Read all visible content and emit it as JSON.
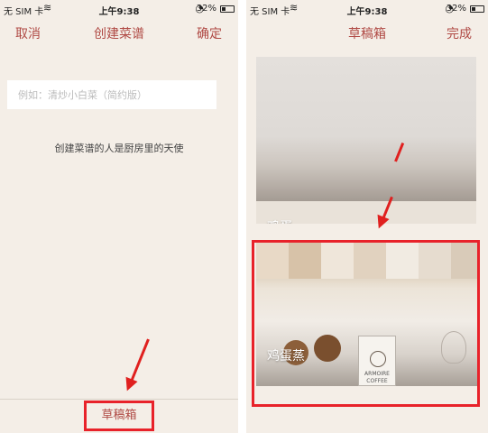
{
  "left_screen": {
    "status_bar": {
      "carrier": "无 SIM 卡",
      "time": "上午9:38",
      "battery": "32%"
    },
    "nav": {
      "cancel": "取消",
      "title": "创建菜谱",
      "confirm": "确定"
    },
    "recipe_name_placeholder": "例如：清炒小白菜（简约版）",
    "tip": "创建菜谱的人是厨房里的天使",
    "draft_box_button": "草稿箱"
  },
  "right_screen": {
    "status_bar": {
      "carrier": "无 SIM 卡",
      "time": "上午9:38",
      "battery": "32%"
    },
    "nav": {
      "title": "草稿箱",
      "done": "完成"
    },
    "drafts": [
      {
        "title": "鸡蛋"
      },
      {
        "title": "鸡蛋蒸"
      }
    ],
    "photo_labels": {
      "cup_line1": "ARMOIRE",
      "cup_line2": "COFFEE"
    }
  },
  "colors": {
    "accent": "#b04a45",
    "annotation_red": "#e8222a",
    "background": "#f4eee7"
  }
}
